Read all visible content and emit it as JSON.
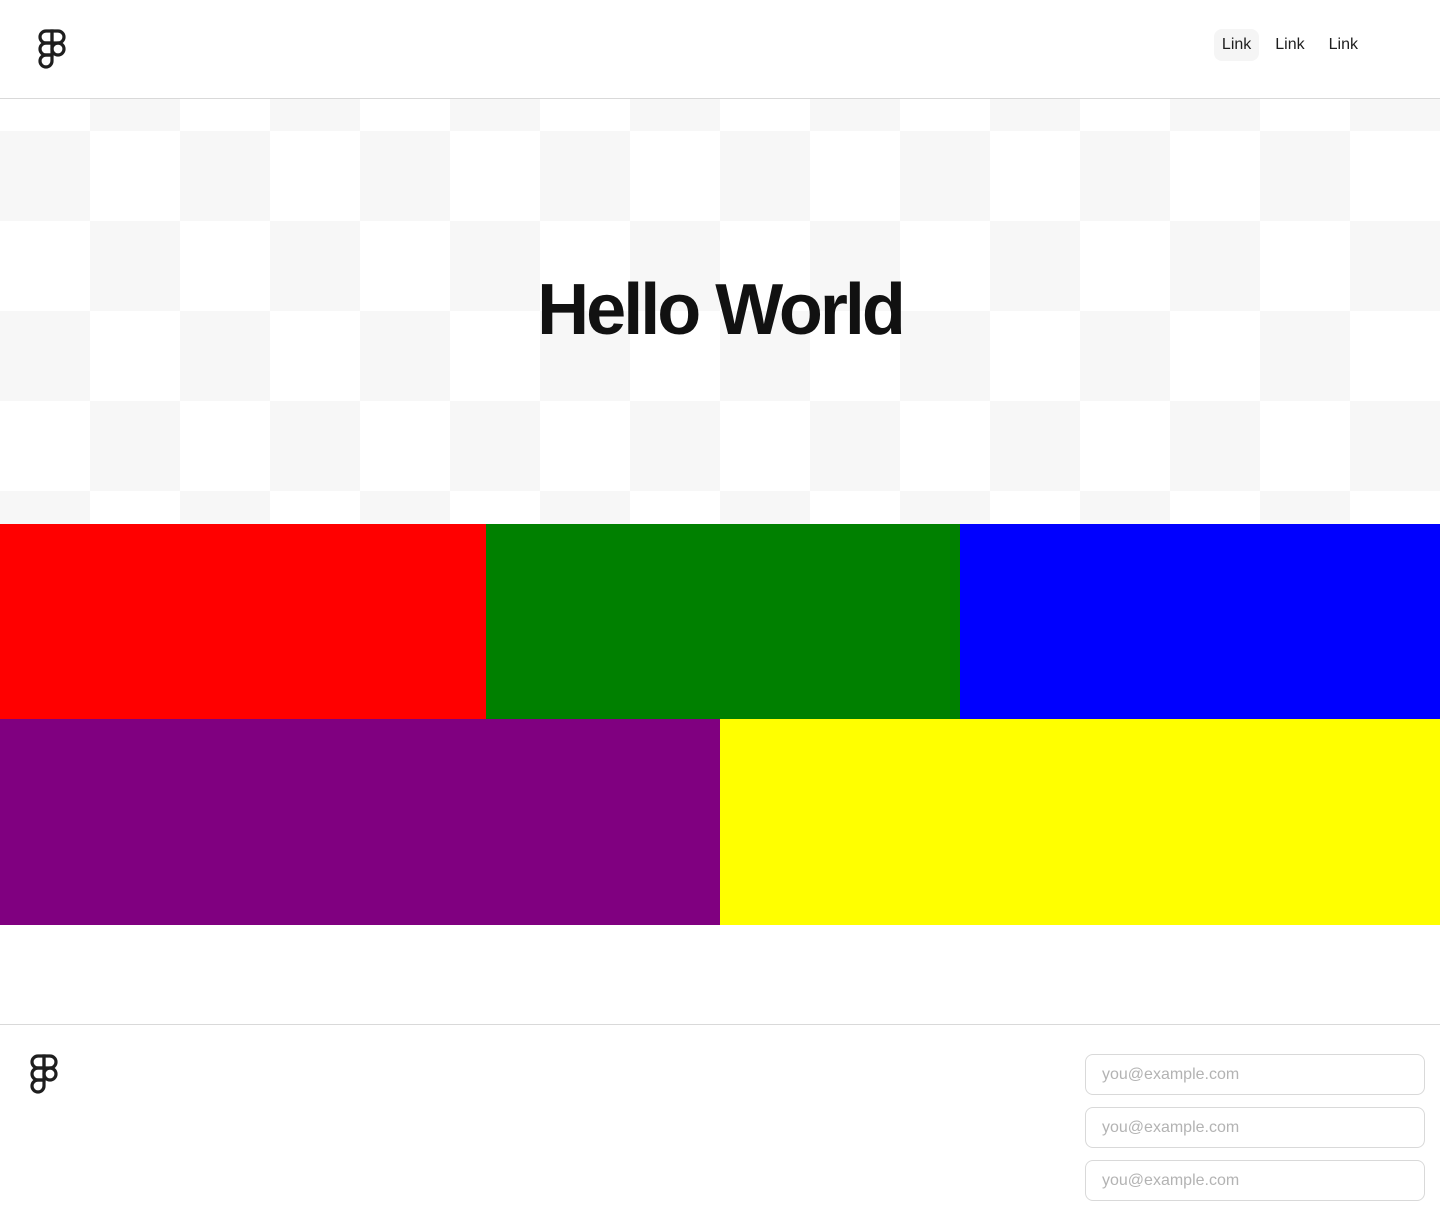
{
  "header": {
    "logo_icon": "figma-logo-icon",
    "nav": [
      {
        "label": "Link",
        "active": true
      },
      {
        "label": "Link",
        "active": false
      },
      {
        "label": "Link",
        "active": false
      }
    ]
  },
  "hero": {
    "title": "Hello World",
    "background": "checkerboard",
    "checker_color": "#f7f7f7"
  },
  "blocks": [
    {
      "name": "red",
      "color": "#ff0000"
    },
    {
      "name": "green",
      "color": "#008000"
    },
    {
      "name": "blue",
      "color": "#0000ff"
    },
    {
      "name": "purple",
      "color": "#800080"
    },
    {
      "name": "yellow",
      "color": "#ffff00"
    }
  ],
  "footer": {
    "logo_icon": "figma-logo-icon",
    "form": {
      "fields": [
        {
          "value": "",
          "placeholder": "you@example.com"
        },
        {
          "value": "",
          "placeholder": "you@example.com"
        },
        {
          "value": "",
          "placeholder": "you@example.com"
        }
      ]
    }
  }
}
